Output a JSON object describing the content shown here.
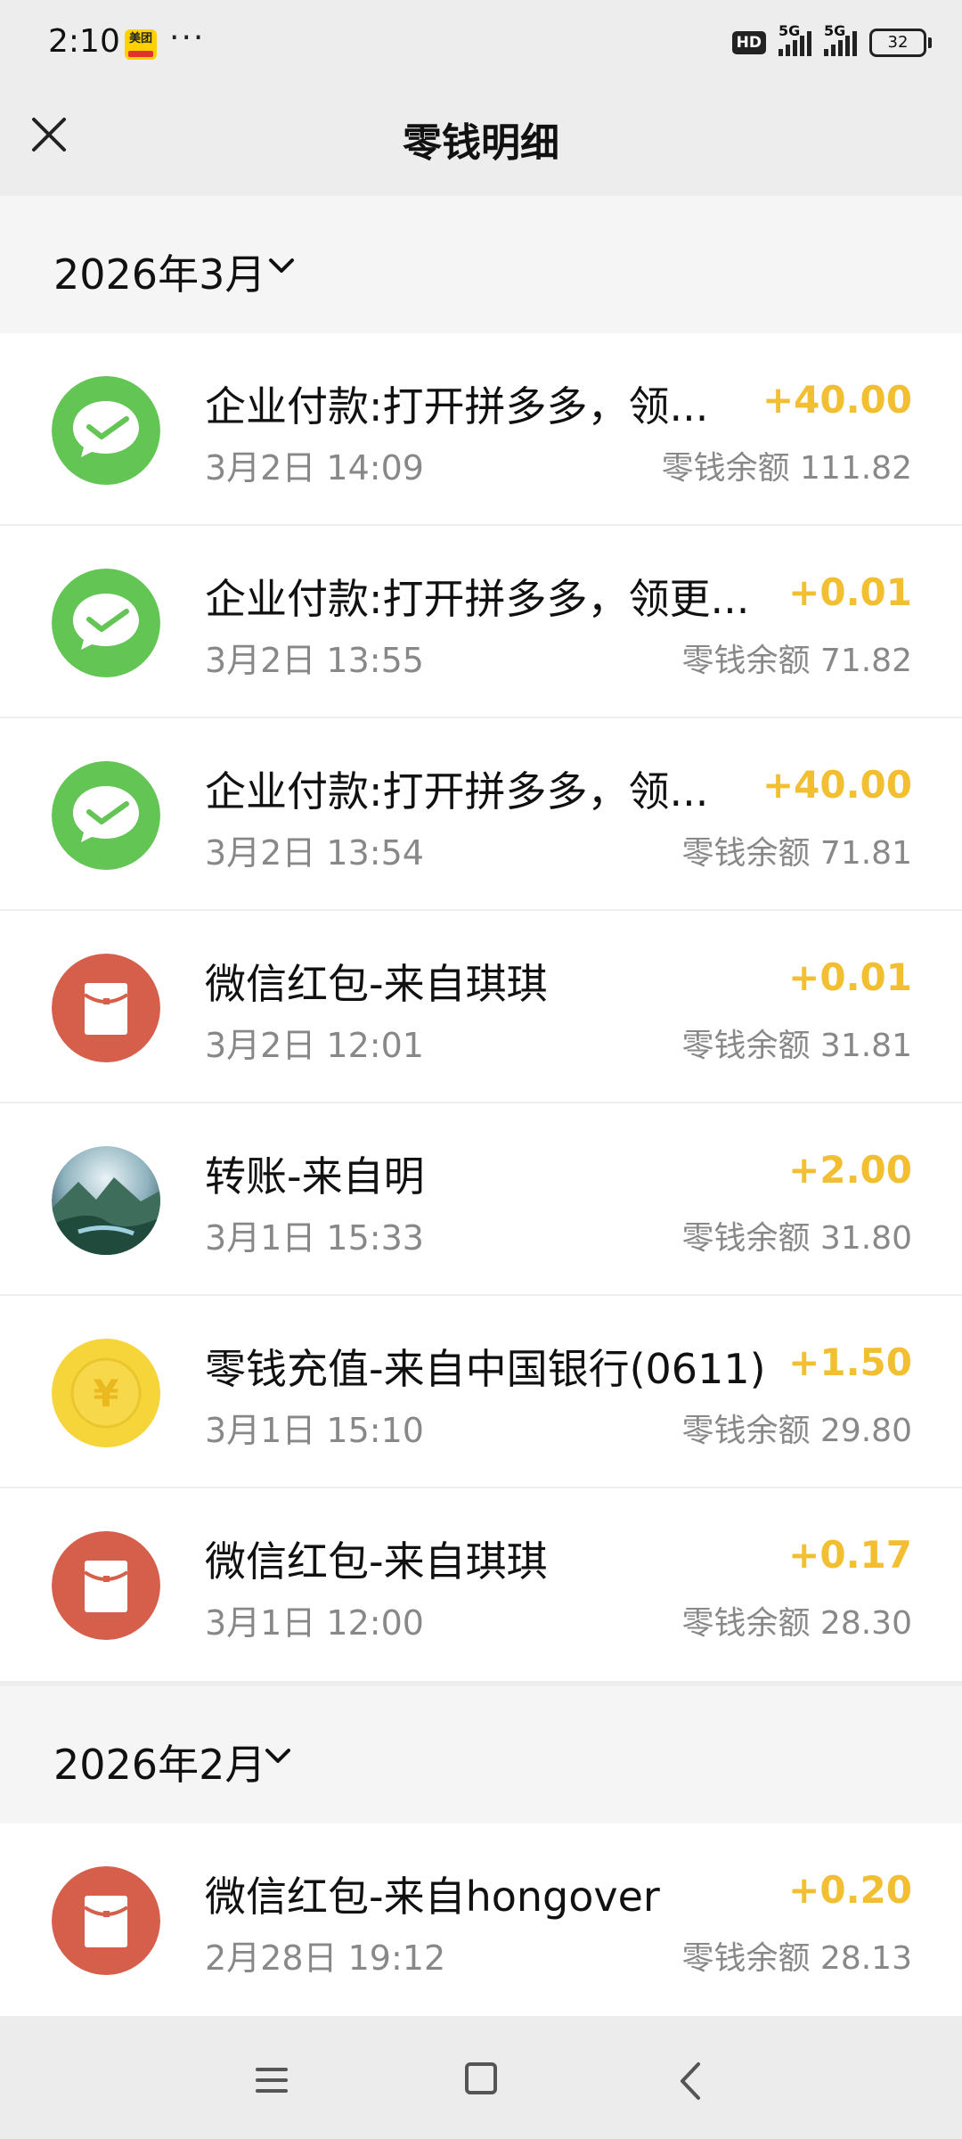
{
  "status_bar": {
    "time": "2:10",
    "app_badge": "美团",
    "more": "···",
    "hd": "HD",
    "net1": "5G",
    "net2": "5G",
    "battery": "32"
  },
  "header": {
    "title": "零钱明细"
  },
  "sections": [
    {
      "month": "2026年3月",
      "transactions": [
        {
          "icon": "wechat-pay-icon",
          "title": "企业付款:打开拼多多，领...",
          "date": "3月2日 14:09",
          "amount": "+40.00",
          "balance": "零钱余额 111.82"
        },
        {
          "icon": "wechat-pay-icon",
          "title": "企业付款:打开拼多多，领更...",
          "date": "3月2日 13:55",
          "amount": "+0.01",
          "balance": "零钱余额 71.82"
        },
        {
          "icon": "wechat-pay-icon",
          "title": "企业付款:打开拼多多，领...",
          "date": "3月2日 13:54",
          "amount": "+40.00",
          "balance": "零钱余额 71.81"
        },
        {
          "icon": "red-packet-icon",
          "title": "微信红包-来自琪琪",
          "date": "3月2日 12:01",
          "amount": "+0.01",
          "balance": "零钱余额 31.81"
        },
        {
          "icon": "landscape-avatar",
          "title": "转账-来自明",
          "date": "3月1日 15:33",
          "amount": "+2.00",
          "balance": "零钱余额 31.80"
        },
        {
          "icon": "yuan-coin-icon",
          "title": "零钱充值-来自中国银行(0611)",
          "date": "3月1日 15:10",
          "amount": "+1.50",
          "balance": "零钱余额 29.80"
        },
        {
          "icon": "red-packet-icon",
          "title": "微信红包-来自琪琪",
          "date": "3月1日 12:00",
          "amount": "+0.17",
          "balance": "零钱余额 28.30"
        }
      ]
    },
    {
      "month": "2026年2月",
      "transactions": [
        {
          "icon": "red-packet-icon",
          "title": "微信红包-来自hongover",
          "date": "2月28日 19:12",
          "amount": "+0.20",
          "balance": "零钱余额 28.13"
        }
      ]
    }
  ],
  "colors": {
    "amount": "#f3bf32",
    "wechat_green": "#62c554",
    "red_packet": "#d65f4c",
    "coin": "#f5d53a"
  }
}
